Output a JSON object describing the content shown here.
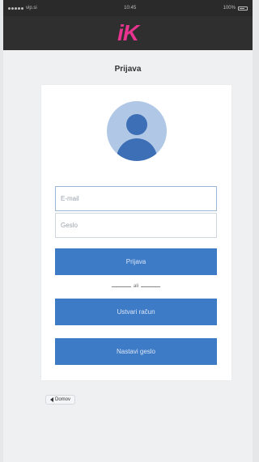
{
  "statusbar": {
    "carrier": "vip.si",
    "time": "10:45",
    "battery": "100%"
  },
  "appbar": {
    "logo": "iK"
  },
  "page": {
    "title": "Prijava"
  },
  "form": {
    "email_placeholder": "E-mail",
    "password_placeholder": "Geslo",
    "login_label": "Prijava",
    "divider_text": "ali",
    "register_label": "Ustvari račun",
    "forgot_label": "Nastavi geslo"
  },
  "nav": {
    "back_label": "Domov"
  },
  "colors": {
    "primary": "#3e7bc7",
    "brand": "#e8348f",
    "header": "#2f2f2f"
  }
}
